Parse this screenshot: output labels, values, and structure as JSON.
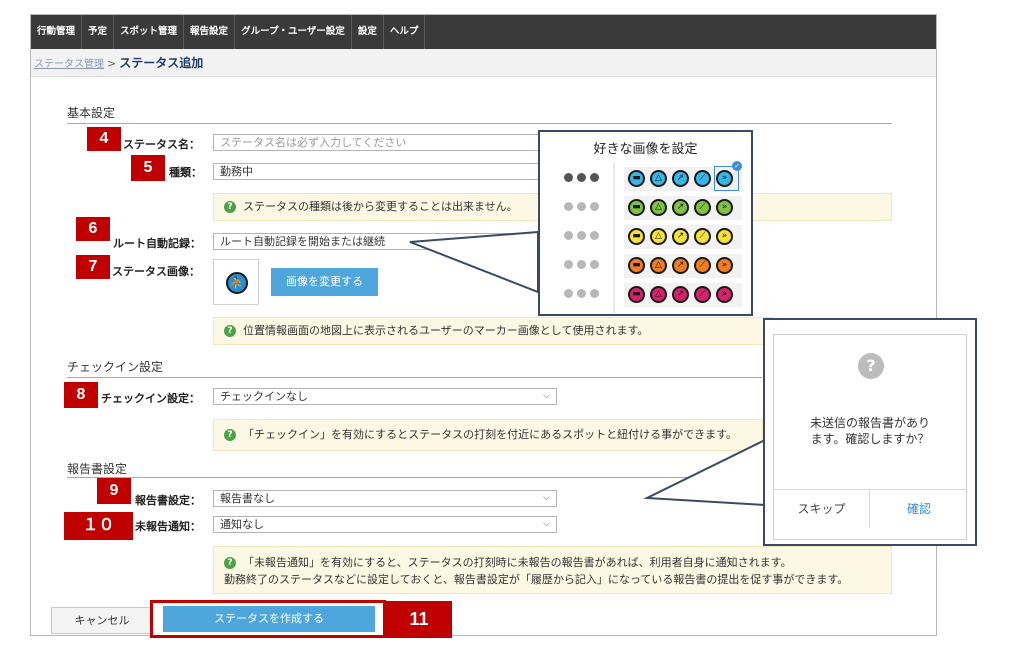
{
  "nav": {
    "items": [
      "行動管理",
      "予定",
      "スポット管理",
      "報告設定",
      "グループ・ユーザー設定",
      "設定",
      "ヘルプ"
    ]
  },
  "breadcrumb": {
    "parent": "ステータス管理",
    "separator": ">",
    "current": "ステータス追加"
  },
  "basic": {
    "title": "基本設定",
    "name_label": "ステータス名：",
    "name_placeholder": "ステータス名は必ず入力してください",
    "type_label": "種類：",
    "type_value": "勤務中",
    "type_note": "ステータスの種類は後から変更することは出来ません。",
    "route_label": "ルート自動記録：",
    "route_value": "ルート自動記録を開始または継続",
    "image_label": "ステータス画像：",
    "change_image_button": "画像を変更する",
    "image_note": "位置情報画面の地図上に表示されるユーザーのマーカー画像として使用されます。"
  },
  "checkin": {
    "title": "チェックイン設定",
    "label": "チェックイン設定：",
    "value": "チェックインなし",
    "note": "「チェックイン」を有効にするとステータスの打刻を付近にあるスポットと紐付ける事ができます。"
  },
  "report": {
    "title": "報告書設定",
    "setting_label": "報告書設定：",
    "setting_value": "報告書なし",
    "notify_label": "未報告通知：",
    "notify_value": "通知なし",
    "note_line1": "「未報告通知」を有効にすると、ステータスの打刻時に未報告の報告書があれば、利用者自身に通知されます。",
    "note_line2": "勤務終了のステータスなどに設定しておくと、報告書設定が「履歴から記入」になっている報告書の提出を促す事ができます。"
  },
  "footer": {
    "cancel": "キャンセル",
    "create": "ステータスを作成する"
  },
  "tags": [
    "4",
    "5",
    "6",
    "7",
    "8",
    "9",
    "１０",
    "11"
  ],
  "image_callout": {
    "caption": "好きな画像を設定",
    "palette_colors": [
      "#38b6e8",
      "#7fc241",
      "#f4e23a",
      "#f07d1e",
      "#d6226b"
    ],
    "palette_icons": [
      "chat-icon",
      "warning-icon",
      "walking-icon",
      "wrench-icon",
      "running-icon"
    ]
  },
  "dialog": {
    "message_line1": "未送信の報告書があり",
    "message_line2": "ます。確認しますか？",
    "skip": "スキップ",
    "confirm": "確認",
    "icon": "?"
  },
  "colors": {
    "nav_bg": "#3a3a3a",
    "accent_blue": "#4ea6dc",
    "tag_red": "#c00000",
    "note_bg": "#fdf8e4"
  }
}
